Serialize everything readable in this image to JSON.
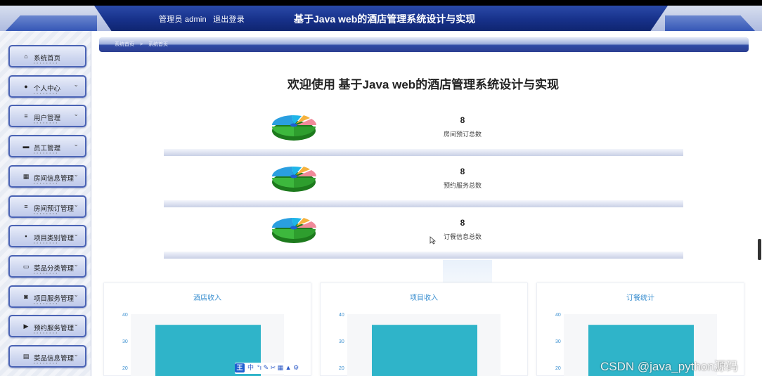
{
  "header": {
    "role_label": "管理员 admin",
    "logout_label": "退出登录",
    "title": "基于Java web的酒店管理系统设计与实现"
  },
  "sidebar": {
    "items": [
      {
        "label": "系统首页",
        "icon": "home-icon",
        "has_submenu": false
      },
      {
        "label": "个人中心",
        "icon": "user-icon",
        "has_submenu": true
      },
      {
        "label": "用户管理",
        "icon": "list-icon",
        "has_submenu": true
      },
      {
        "label": "员工管理",
        "icon": "monitor-icon",
        "has_submenu": true
      },
      {
        "label": "房间信息管理",
        "icon": "grid-icon",
        "has_submenu": true
      },
      {
        "label": "房间预订管理",
        "icon": "list-icon",
        "has_submenu": true
      },
      {
        "label": "项目类别管理",
        "icon": "apps-icon",
        "has_submenu": true
      },
      {
        "label": "菜品分类管理",
        "icon": "desktop-icon",
        "has_submenu": true
      },
      {
        "label": "项目服务管理",
        "icon": "tag-icon",
        "has_submenu": true
      },
      {
        "label": "预约服务管理",
        "icon": "video-icon",
        "has_submenu": true
      },
      {
        "label": "菜品信息管理",
        "icon": "message-icon",
        "has_submenu": true
      }
    ]
  },
  "breadcrumb": {
    "items": [
      "系统首页",
      ">",
      "系统首页"
    ]
  },
  "main": {
    "welcome": "欢迎使用 基于Java web的酒店管理系统设计与实现",
    "stats": [
      {
        "value": "8",
        "label": "房间预订总数"
      },
      {
        "value": "8",
        "label": "预约服务总数"
      },
      {
        "value": "8",
        "label": "订餐信息总数"
      }
    ]
  },
  "chart_data": [
    {
      "type": "bar",
      "title": "酒店收入",
      "yticks": [
        "40",
        "30",
        "20"
      ],
      "ylim": [
        20,
        40
      ],
      "values": [
        36
      ]
    },
    {
      "type": "bar",
      "title": "项目收入",
      "yticks": [
        "40",
        "30",
        "20"
      ],
      "ylim": [
        20,
        40
      ],
      "values": [
        36
      ]
    },
    {
      "type": "bar",
      "title": "订餐统计",
      "yticks": [
        "40",
        "30",
        "20"
      ],
      "ylim": [
        20,
        40
      ],
      "values": [
        36
      ]
    }
  ],
  "toolbar": {
    "main_label": "王",
    "ime_label": "中",
    "extra_glyphs": "°ı ✎ ✂ ▦ ▲ ⚙"
  },
  "watermark": "CSDN @java_python源码",
  "colors": {
    "header_band": "#17318a",
    "menu_border": "#4a63b5",
    "bar": "#2fb4c9",
    "chart_title": "#3a8fd0"
  }
}
